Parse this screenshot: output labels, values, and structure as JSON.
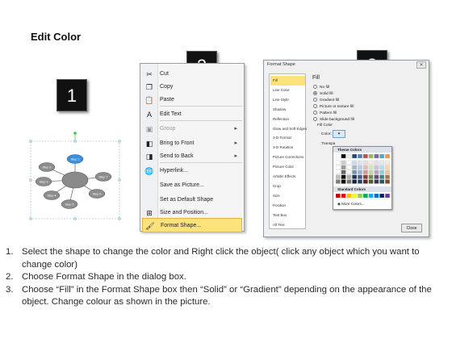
{
  "title": "Edit Color",
  "badges": [
    "1",
    "2",
    "3"
  ],
  "diagram": {
    "nodes": [
      "Step 1",
      "Step 2",
      "Step 3",
      "Step 4",
      "Step 5",
      "Step 6",
      "Step 7"
    ]
  },
  "context_menu": {
    "items": [
      {
        "label": "Cut",
        "icon": "scissors-icon",
        "glyph": "✂",
        "state": "normal",
        "submenu": false
      },
      {
        "label": "Copy",
        "icon": "copy-icon",
        "glyph": "❐",
        "state": "normal",
        "submenu": false
      },
      {
        "label": "Paste",
        "icon": "clipboard-icon",
        "glyph": "📋",
        "state": "normal",
        "submenu": false
      },
      {
        "label": "Edit Text",
        "icon": "edit-text-icon",
        "glyph": "A",
        "state": "normal",
        "submenu": false
      },
      {
        "label": "Group",
        "icon": "group-icon",
        "glyph": "▣",
        "state": "disabled",
        "submenu": true
      },
      {
        "label": "Bring to Front",
        "icon": "bring-front-icon",
        "glyph": "◧",
        "state": "normal",
        "submenu": true
      },
      {
        "label": "Send to Back",
        "icon": "send-back-icon",
        "glyph": "◨",
        "state": "normal",
        "submenu": true
      },
      {
        "label": "Hyperlink...",
        "icon": "hyperlink-icon",
        "glyph": "🌐",
        "state": "normal",
        "submenu": false
      },
      {
        "label": "Save as Picture...",
        "icon": "",
        "glyph": "",
        "state": "normal",
        "submenu": false
      },
      {
        "label": "Set as Default Shape",
        "icon": "",
        "glyph": "",
        "state": "normal",
        "submenu": false
      },
      {
        "label": "Size and Position...",
        "icon": "size-position-icon",
        "glyph": "⊞",
        "state": "normal",
        "submenu": false
      },
      {
        "label": "Format Shape...",
        "icon": "format-shape-icon",
        "glyph": "🖌",
        "state": "highlight",
        "submenu": false
      }
    ]
  },
  "format_dialog": {
    "title": "Format Shape",
    "categories": [
      "Fill",
      "Line Color",
      "Line Style",
      "Shadow",
      "Reflection",
      "Glow and Soft Edges",
      "3-D Format",
      "3-D Rotation",
      "Picture Corrections",
      "Picture Color",
      "Artistic Effects",
      "Crop",
      "Size",
      "Position",
      "Text Box",
      "Alt Text"
    ],
    "active_category": "Fill",
    "fill_heading": "Fill",
    "fill_options": [
      "No fill",
      "Solid fill",
      "Gradient fill",
      "Picture or texture fill",
      "Pattern fill",
      "Slide background fill"
    ],
    "selected_fill": "Solid fill",
    "fill_color_label": "Fill Color",
    "color_label": "Color:",
    "transparency_label": "Transpa",
    "close_label": "Close"
  },
  "color_palette": {
    "theme_header": "Theme Colors",
    "standard_header": "Standard Colors",
    "more_colors": "More Colors...",
    "theme_top": [
      "#ffffff",
      "#000000",
      "#eeece1",
      "#1f497d",
      "#4f81bd",
      "#c0504d",
      "#9bbb59",
      "#8064a2",
      "#4bacc6",
      "#f79646"
    ],
    "standard": [
      "#c00000",
      "#ff0000",
      "#ffc000",
      "#ffff00",
      "#92d050",
      "#00b050",
      "#00b0f0",
      "#0070c0",
      "#002060",
      "#7030a0"
    ]
  },
  "instructions": [
    {
      "num": "1.",
      "text": "Select the shape to change the color and Right click the object( click any object which you want to change color)"
    },
    {
      "num": "2.",
      "text": "Choose Format Shape in the dialog box."
    },
    {
      "num": "3.",
      "text": "Choose “Fill” in the Format Shape box then “Solid” or “Gradient” depending on the appearance of the object. Change colour as shown in the picture."
    }
  ]
}
